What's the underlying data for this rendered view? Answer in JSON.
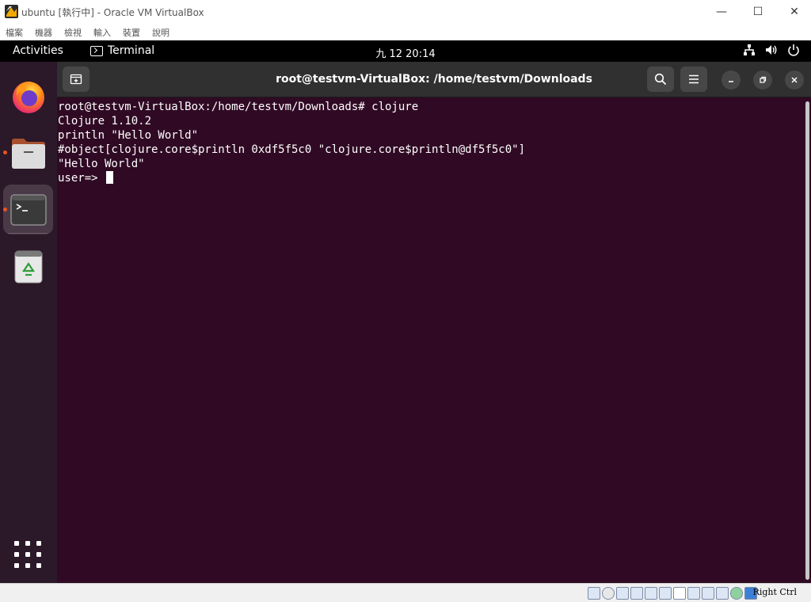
{
  "vbox": {
    "title": "ubuntu [執行中] - Oracle VM VirtualBox",
    "menu": [
      "檔案",
      "機器",
      "檢視",
      "輸入",
      "裝置",
      "說明"
    ],
    "minimize_glyph": "—",
    "maximize_glyph": "☐",
    "close_glyph": "✕",
    "host_key": "Right Ctrl",
    "status_icons": [
      "hard-disk-icon",
      "optical-disk-icon",
      "audio-icon",
      "network-icon",
      "usb-icon",
      "shared-folder-icon",
      "display-icon",
      "video-capture-icon",
      "mouse-integration-icon",
      "keyboard-icon",
      "cpu-icon",
      "host-key-arrow-icon"
    ]
  },
  "gnome": {
    "activities": "Activities",
    "app_name": "Terminal",
    "clock": "九 12 20:14",
    "tray": [
      "network-icon",
      "volume-icon",
      "power-icon"
    ]
  },
  "dock": {
    "items": [
      {
        "name": "firefox",
        "running": false,
        "active": false
      },
      {
        "name": "files",
        "running": true,
        "active": false
      },
      {
        "name": "terminal",
        "running": true,
        "active": true
      },
      {
        "name": "trash",
        "running": false,
        "active": false
      }
    ],
    "show_apps": "show-applications"
  },
  "terminal": {
    "title": "root@testvm-VirtualBox: /home/testvm/Downloads",
    "lines": [
      "root@testvm-VirtualBox:/home/testvm/Downloads# clojure",
      "Clojure 1.10.2",
      "println \"Hello World\"",
      "#object[clojure.core$println 0xdf5f5c0 \"clojure.core$println@df5f5c0\"]",
      "\"Hello World\""
    ],
    "prompt": "user=> "
  },
  "colors": {
    "terminal_bg": "#300a24",
    "header_bg": "#303030",
    "accent": "#e95420",
    "topbar_bg": "#000000"
  }
}
